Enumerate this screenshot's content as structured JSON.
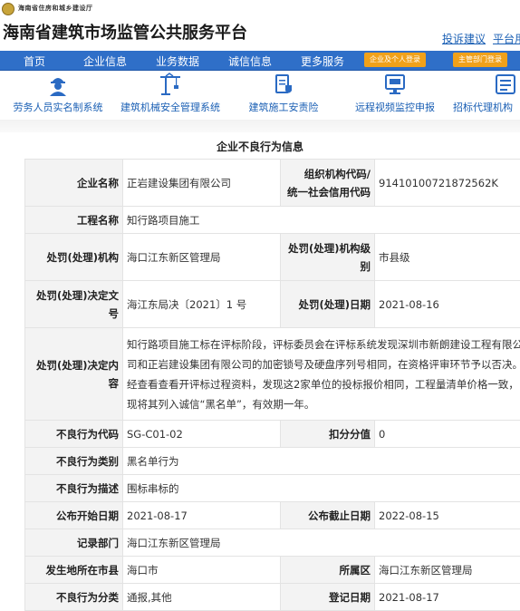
{
  "header": {
    "dept_name": "海南省住房和城乡建设厅",
    "site_title": "海南省建筑市场监管公共服务平台",
    "links": [
      "投诉建议",
      "平台用"
    ]
  },
  "nav": {
    "items": [
      "首页",
      "企业信息",
      "业务数据",
      "诚信信息",
      "更多服务"
    ],
    "buttons": [
      "企业及个人登录",
      "主管部门登录"
    ],
    "accent_color": "#2f6fc8",
    "button_color": "#f0a11a"
  },
  "systems": [
    {
      "label": "劳务人员实名制系统",
      "icon": "worker-helmet-icon"
    },
    {
      "label": "建筑机械安全管理系统",
      "icon": "tower-crane-icon"
    },
    {
      "label": "建筑施工安责险",
      "icon": "document-shield-icon"
    },
    {
      "label": "远程视频监控申报",
      "icon": "monitor-report-icon"
    },
    {
      "label": "招标代理机构",
      "icon": "bidding-agent-icon"
    }
  ],
  "section_title": "企业不良行为信息",
  "record": {
    "company_label": "企业名称",
    "company": "正岩建设集团有限公司",
    "org_code_label_1": "组织机构代码/",
    "org_code_label_2": "统一社会信用代码",
    "org_code": "91410100721872562K",
    "project_label": "工程名称",
    "project": "知行路项目施工",
    "authority_label": "处罚(处理)机构",
    "authority": "海口江东新区管理局",
    "authority_level_label": "处罚(处理)机构级别",
    "authority_level": "市县级",
    "decision_no_label": "处罚(处理)决定文号",
    "decision_no": "海江东局决〔2021〕1 号",
    "penalty_date_label": "处罚(处理)日期",
    "penalty_date": "2021-08-16",
    "decision_content_label": "处罚(处理)决定内容",
    "decision_content": "知行路项目施工标在评标阶段，评标委员会在评标系统发现深圳市新朗建设工程有限公司和正岩建设集团有限公司的加密锁号及硬盘序列号相同，在资格评审环节予以否决。经查看查看开评标过程资料，发现这2家单位的投标报价相同，工程量清单价格一致，现将其列入诚信“黑名单”，有效期一年。",
    "behavior_code_label": "不良行为代码",
    "behavior_code": "SG-C01-02",
    "deduct_label": "扣分分值",
    "deduct": "0",
    "category_label": "不良行为类别",
    "category": "黑名单行为",
    "description_label": "不良行为描述",
    "description": "围标串标的",
    "publish_start_label": "公布开始日期",
    "publish_start": "2021-08-17",
    "publish_end_label": "公布截止日期",
    "publish_end": "2022-08-15",
    "record_dept_label": "记录部门",
    "record_dept": "海口江东新区管理局",
    "city_label": "发生地所在市县",
    "city": "海口市",
    "district_label": "所属区",
    "district": "海口江东新区管理局",
    "class_label": "不良行为分类",
    "class": "通报,其他",
    "register_date_label": "登记日期",
    "register_date": "2021-08-17"
  }
}
